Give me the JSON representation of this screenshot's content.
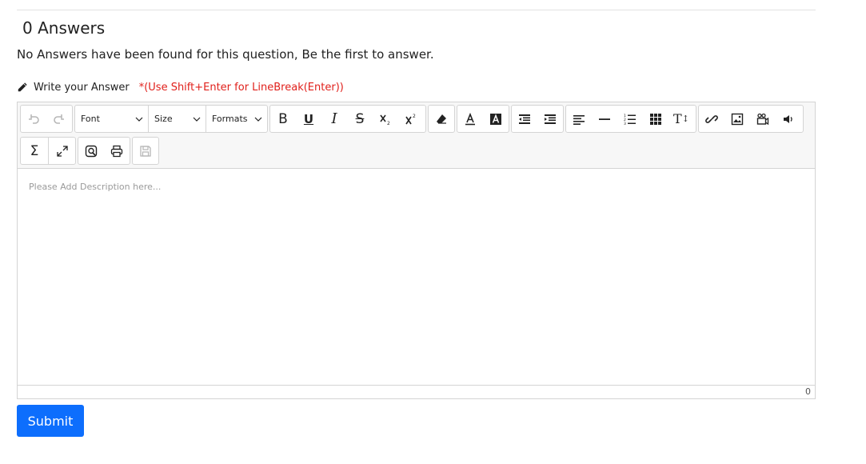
{
  "answers": {
    "title": "0 Answers",
    "empty_message": "No Answers have been found for this question, Be the first to answer."
  },
  "write": {
    "label": "Write your Answer",
    "hint": "*(Use Shift+Enter for LineBreak(Enter))",
    "icon": "pencil-icon"
  },
  "editor": {
    "font_select": "Font",
    "size_select": "Size",
    "formats_select": "Formats",
    "placeholder": "Please Add Description here...",
    "word_count": "0",
    "buttons": {
      "bold": "B",
      "underline": "U",
      "italic": "I",
      "strike": "S",
      "sigma": "Σ",
      "text_style": "T"
    }
  },
  "submit_label": "Submit",
  "colors": {
    "accent": "#0d6efd",
    "hint": "#e0201b"
  }
}
